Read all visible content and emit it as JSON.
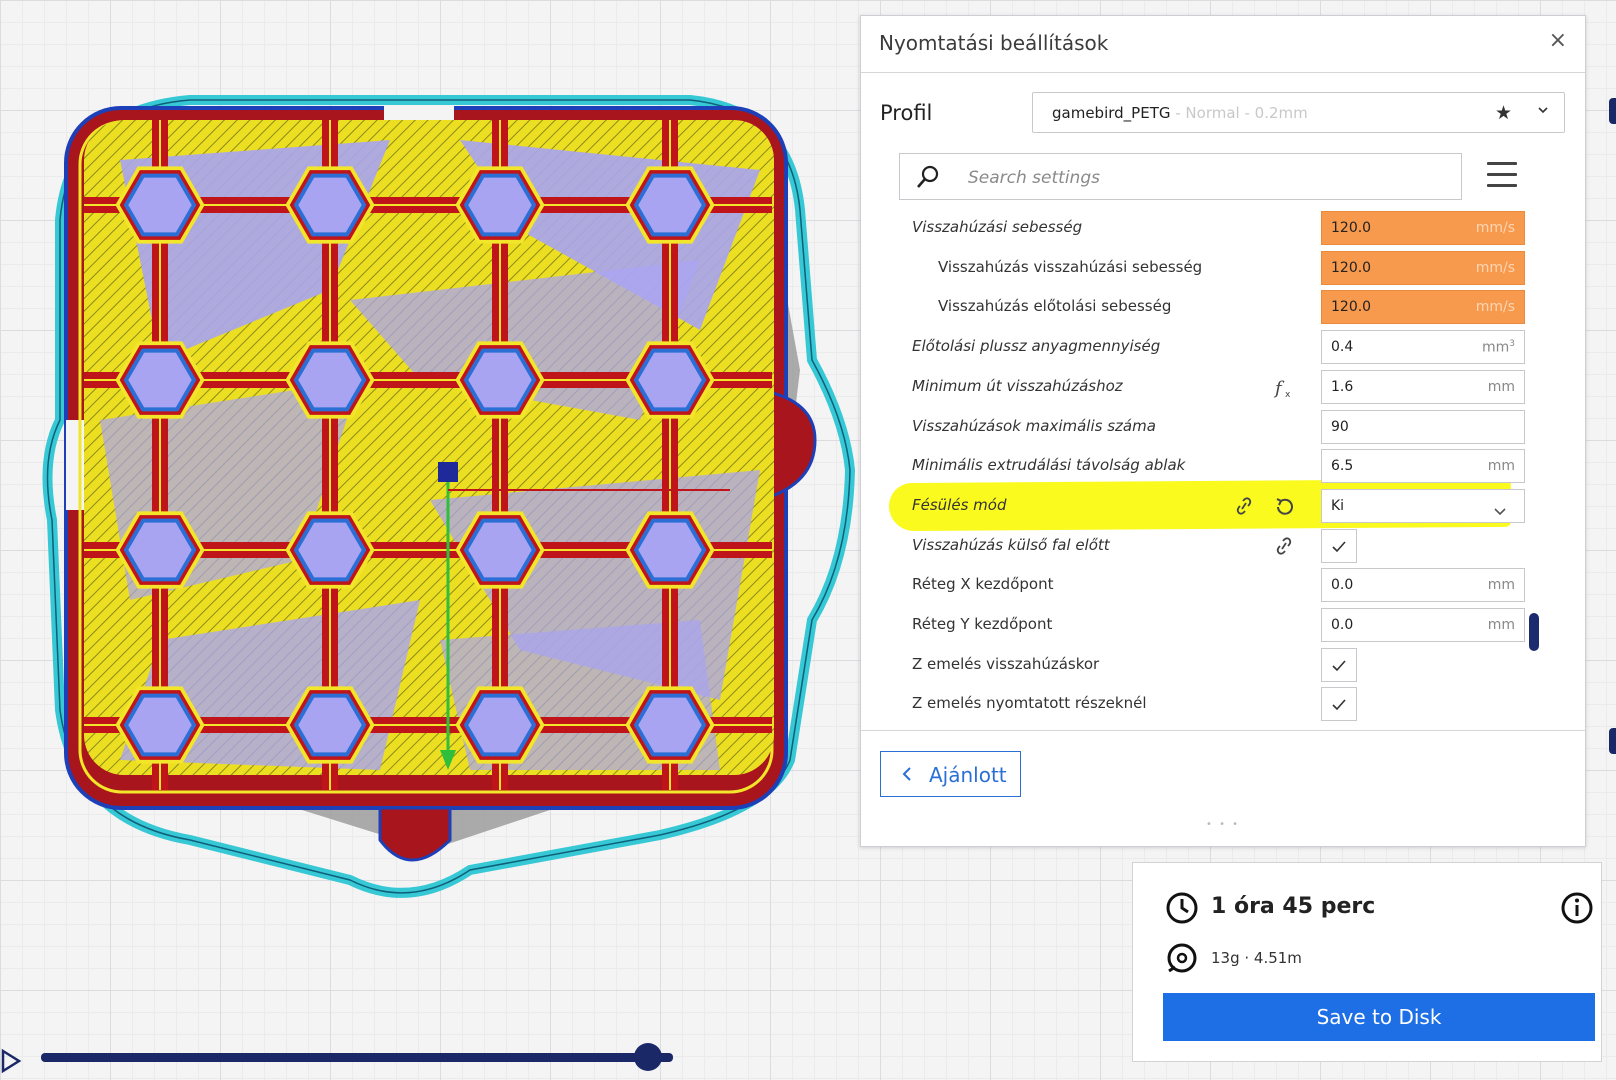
{
  "panel": {
    "title": "Nyomtatási beállítások",
    "close_label": "×",
    "profile_label": "Profil",
    "profile_name": "gamebird_PETG",
    "profile_sub": " - Normal - 0.2mm",
    "search_placeholder": "Search settings",
    "settings": [
      {
        "label": "Visszahúzási sebesség",
        "value": "120.0",
        "unit": "mm/s",
        "style": "orange",
        "italic": true,
        "indent": 0
      },
      {
        "label": "Visszahúzás visszahúzási sebesség",
        "value": "120.0",
        "unit": "mm/s",
        "style": "orange",
        "italic": false,
        "indent": 1
      },
      {
        "label": "Visszahúzás előtolási sebesség",
        "value": "120.0",
        "unit": "mm/s",
        "style": "orange",
        "italic": false,
        "indent": 1
      },
      {
        "label": "Előtolási plussz anyagmennyiség",
        "value": "0.4",
        "unit": "mm",
        "unit_sup": "3",
        "italic": true,
        "indent": 0
      },
      {
        "label": "Minimum út visszahúzáshoz",
        "value": "1.6",
        "unit": "mm",
        "italic": true,
        "indent": 0,
        "icons": [
          "function-icon"
        ]
      },
      {
        "label": "Visszahúzások maximális száma",
        "value": "90",
        "unit": "",
        "italic": true,
        "indent": 0
      },
      {
        "label": "Minimális extrudálási távolság ablak",
        "value": "6.5",
        "unit": "mm",
        "italic": true,
        "indent": 0
      },
      {
        "label": "Fésülés mód",
        "value": "Ki",
        "type": "combo",
        "italic": true,
        "indent": 0,
        "highlight": true,
        "icons": [
          "link-icon",
          "reset-icon"
        ]
      },
      {
        "label": "Visszahúzás külső fal előtt",
        "type": "check",
        "checked": true,
        "italic": true,
        "indent": 0,
        "icons": [
          "link-icon"
        ]
      },
      {
        "label": "Réteg X kezdőpont",
        "value": "0.0",
        "unit": "mm",
        "italic": false,
        "indent": 0
      },
      {
        "label": "Réteg Y kezdőpont",
        "value": "0.0",
        "unit": "mm",
        "italic": false,
        "indent": 0
      },
      {
        "label": "Z emelés visszahúzáskor",
        "type": "check",
        "checked": true,
        "italic": false,
        "indent": 0
      },
      {
        "label": "Z emelés nyomtatott részeknél",
        "type": "check",
        "checked": true,
        "italic": false,
        "indent": 0
      }
    ],
    "recommended_label": "Ajánlott"
  },
  "print_info": {
    "time": "1 óra 45 perc",
    "material": "13g · 4.51m",
    "save_label": "Save to Disk"
  },
  "layer_slider": {
    "position": 0.96
  },
  "colors": {
    "accent": "#1e6fe6",
    "orange_field": "#f79a4d",
    "highlight": "#fafa1e",
    "wall_red": "#c0141b",
    "infill_yellow": "#f2e52a",
    "travel_purple": "#a9a4f2",
    "skirt_cyan": "#36c8d4",
    "inner_wall_blue": "#2b6fd6"
  }
}
